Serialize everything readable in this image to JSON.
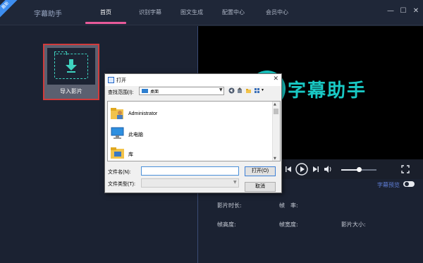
{
  "app": {
    "badge": "最新",
    "title": "字幕助手"
  },
  "nav": {
    "tabs": [
      {
        "label": "首页",
        "active": true
      },
      {
        "label": "识别字幕"
      },
      {
        "label": "图文生成"
      },
      {
        "label": "配置中心"
      },
      {
        "label": "会员中心"
      }
    ]
  },
  "window_controls": {
    "minimize": "—",
    "maximize": "☐",
    "close": "✕"
  },
  "import": {
    "label": "导入影片"
  },
  "video": {
    "watermark": "字幕助手"
  },
  "player": {
    "progress": 0.5
  },
  "subtitle_preview": {
    "label": "字幕预览",
    "enabled": false
  },
  "media_info": {
    "duration_label": "影片时长:",
    "fps_label": "帧　率:",
    "height_label": "帧高度:",
    "width_label": "帧宽度:",
    "size_label": "影片大小:"
  },
  "dialog": {
    "title": "打开",
    "look_in_label": "查找范围(I):",
    "look_in_value": "桌面",
    "items": [
      {
        "label": "Administrator",
        "icon": "user-folder-icon"
      },
      {
        "label": "此电脑",
        "icon": "computer-icon"
      },
      {
        "label": "库",
        "icon": "library-icon"
      }
    ],
    "filename_label": "文件名(N):",
    "filename_value": "",
    "filetype_label": "文件类型(T):",
    "filetype_value": "",
    "open_button": "打开(O)",
    "cancel_button": "取消"
  },
  "colors": {
    "accent": "#e85a9a",
    "teal": "#19c8c4",
    "highlight_border": "#d23b3b",
    "link_blue": "#5f7fd8"
  }
}
